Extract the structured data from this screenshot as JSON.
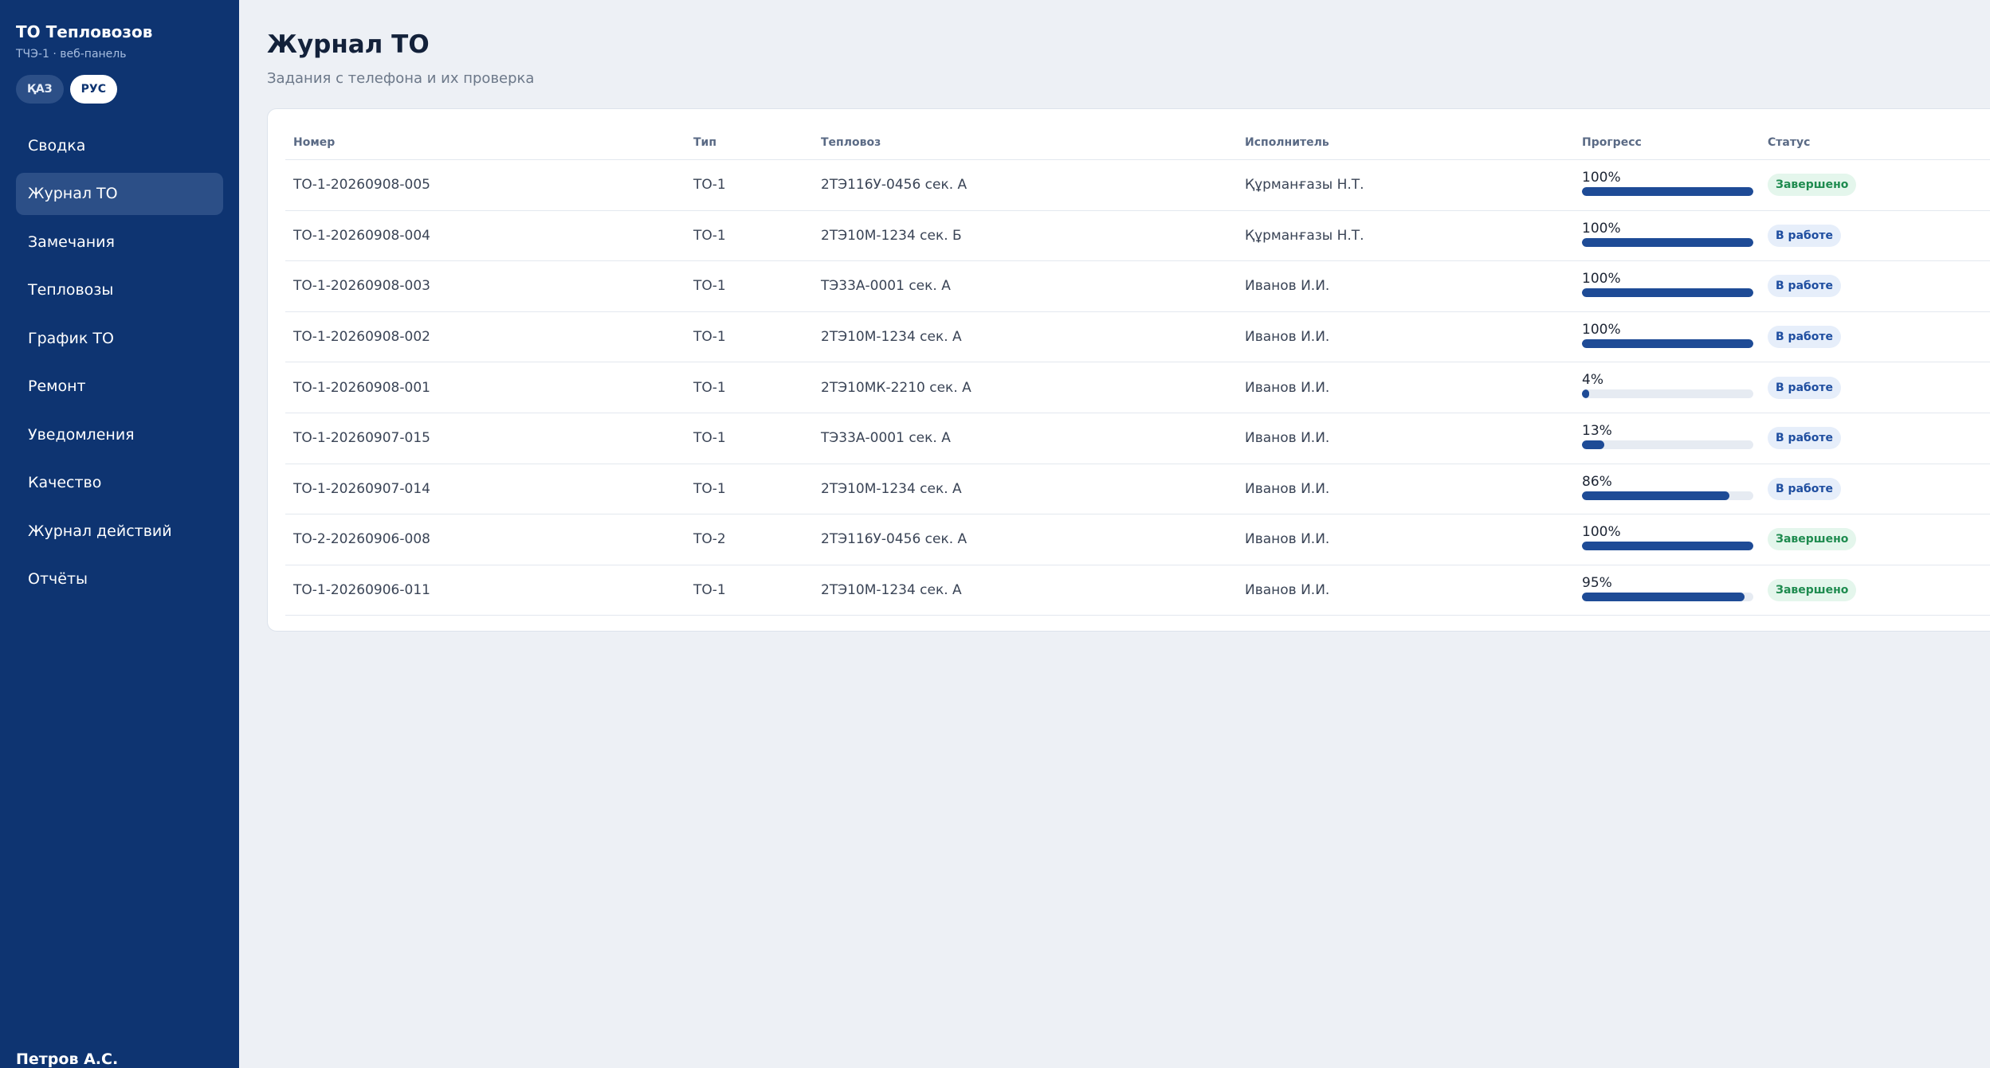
{
  "sidebar": {
    "title": "ТО Тепловозов",
    "subtitle": "ТЧЭ-1 · веб-панель",
    "lang": [
      {
        "label": "ҚАЗ",
        "active": false
      },
      {
        "label": "РУС",
        "active": true
      }
    ],
    "items": [
      {
        "label": "Сводка",
        "active": false
      },
      {
        "label": "Журнал ТО",
        "active": true
      },
      {
        "label": "Замечания",
        "active": false
      },
      {
        "label": "Тепловозы",
        "active": false
      },
      {
        "label": "График ТО",
        "active": false
      },
      {
        "label": "Ремонт",
        "active": false
      },
      {
        "label": "Уведомления",
        "active": false
      },
      {
        "label": "Качество",
        "active": false
      },
      {
        "label": "Журнал действий",
        "active": false
      },
      {
        "label": "Отчёты",
        "active": false
      }
    ],
    "user": "Петров А.С."
  },
  "main": {
    "title": "Журнал ТО",
    "subtitle": "Задания с телефона и их проверка"
  },
  "table": {
    "headers": {
      "number": "Номер",
      "type": "Тип",
      "loco": "Тепловоз",
      "executor": "Исполнитель",
      "progress": "Прогресс",
      "status": "Статус"
    },
    "rows": [
      {
        "number": "ТО-1-20260908-005",
        "type": "ТО-1",
        "loco": "2ТЭ116У-0456 сек. А",
        "executor": "Құрманғазы Н.Т.",
        "progress": 100,
        "progress_label": "100%",
        "status": "Завершено",
        "status_kind": "done"
      },
      {
        "number": "ТО-1-20260908-004",
        "type": "ТО-1",
        "loco": "2ТЭ10М-1234 сек. Б",
        "executor": "Құрманғазы Н.Т.",
        "progress": 100,
        "progress_label": "100%",
        "status": "В работе",
        "status_kind": "work"
      },
      {
        "number": "ТО-1-20260908-003",
        "type": "ТО-1",
        "loco": "ТЭ33А-0001 сек. А",
        "executor": "Иванов И.И.",
        "progress": 100,
        "progress_label": "100%",
        "status": "В работе",
        "status_kind": "work"
      },
      {
        "number": "ТО-1-20260908-002",
        "type": "ТО-1",
        "loco": "2ТЭ10М-1234 сек. А",
        "executor": "Иванов И.И.",
        "progress": 100,
        "progress_label": "100%",
        "status": "В работе",
        "status_kind": "work"
      },
      {
        "number": "ТО-1-20260908-001",
        "type": "ТО-1",
        "loco": "2ТЭ10МК-2210 сек. А",
        "executor": "Иванов И.И.",
        "progress": 4,
        "progress_label": "4%",
        "status": "В работе",
        "status_kind": "work"
      },
      {
        "number": "ТО-1-20260907-015",
        "type": "ТО-1",
        "loco": "ТЭ33А-0001 сек. А",
        "executor": "Иванов И.И.",
        "progress": 13,
        "progress_label": "13%",
        "status": "В работе",
        "status_kind": "work"
      },
      {
        "number": "ТО-1-20260907-014",
        "type": "ТО-1",
        "loco": "2ТЭ10М-1234 сек. А",
        "executor": "Иванов И.И.",
        "progress": 86,
        "progress_label": "86%",
        "status": "В работе",
        "status_kind": "work"
      },
      {
        "number": "ТО-2-20260906-008",
        "type": "ТО-2",
        "loco": "2ТЭ116У-0456 сек. А",
        "executor": "Иванов И.И.",
        "progress": 100,
        "progress_label": "100%",
        "status": "Завершено",
        "status_kind": "done"
      },
      {
        "number": "ТО-1-20260906-011",
        "type": "ТО-1",
        "loco": "2ТЭ10М-1234 сек. А",
        "executor": "Иванов И.И.",
        "progress": 95,
        "progress_label": "95%",
        "status": "Завершено",
        "status_kind": "done"
      }
    ]
  }
}
